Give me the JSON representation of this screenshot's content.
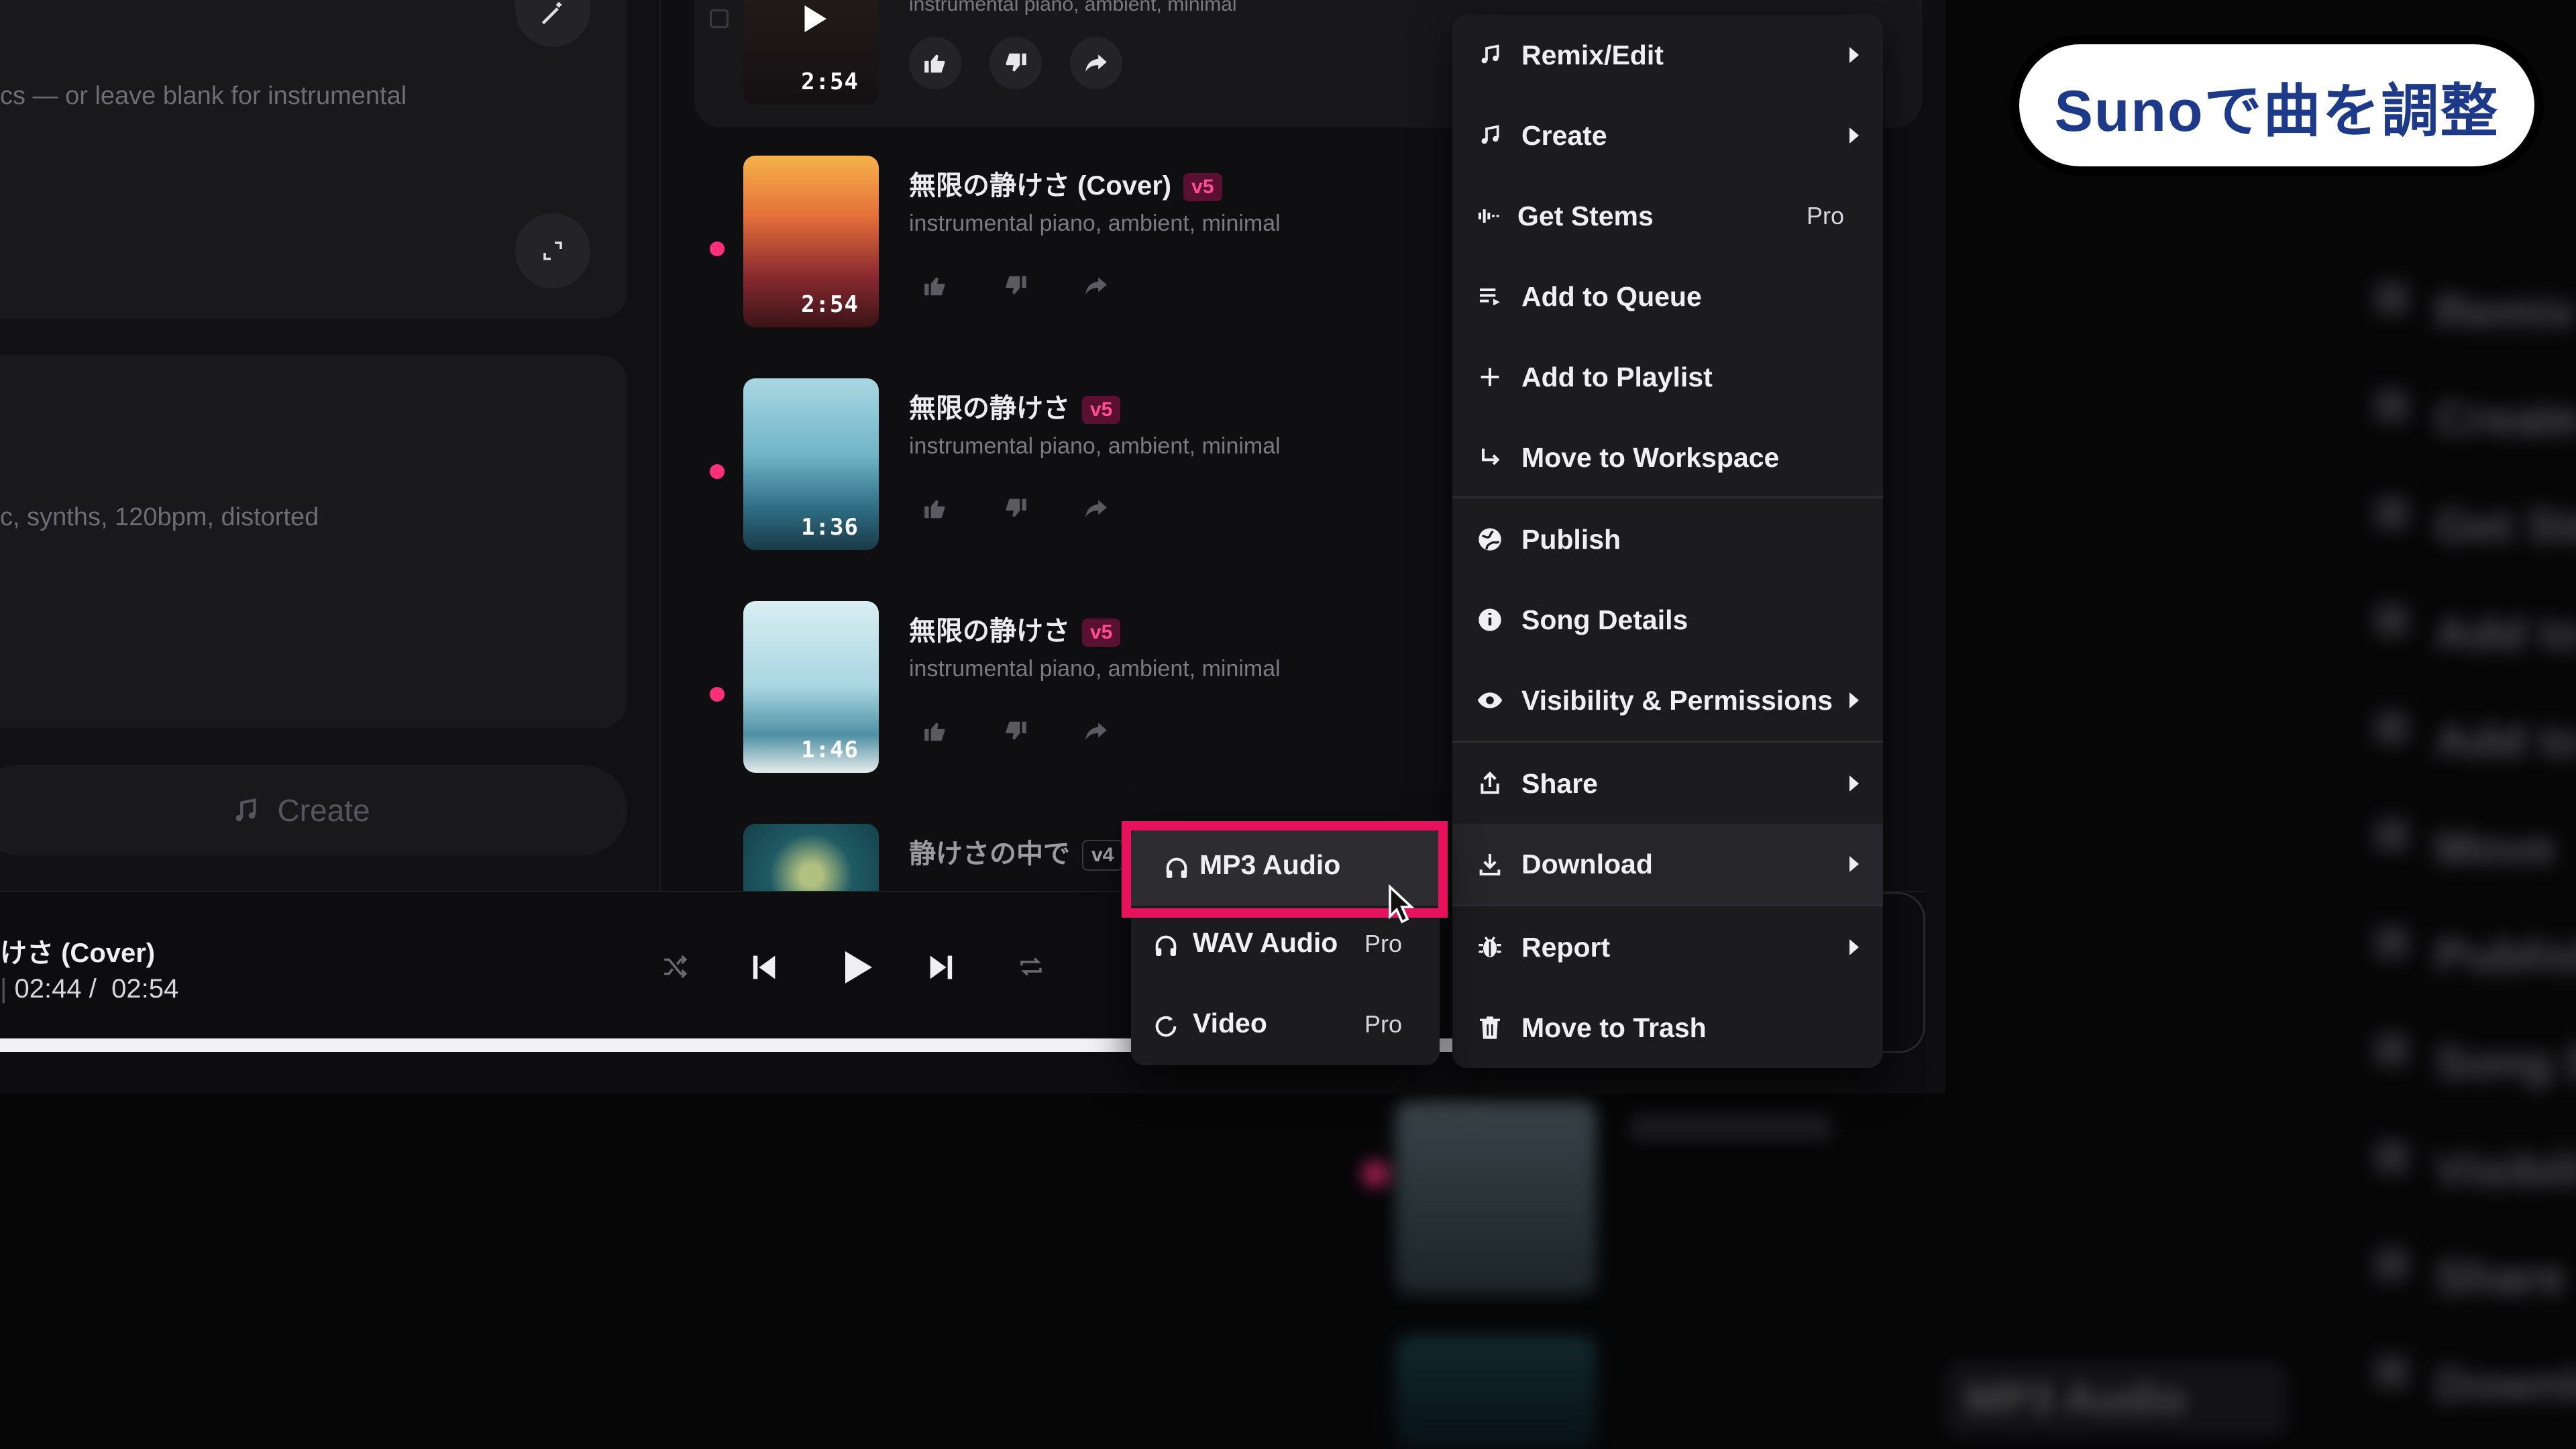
{
  "left_panel": {
    "lyrics_placeholder": "cs — or leave blank for instrumental",
    "style_placeholder": "c, synths, 120bpm, distorted",
    "create_button": "Create"
  },
  "tracks": [
    {
      "title": "",
      "tag": "",
      "subtitle": "instrumental piano, ambient, minimal",
      "duration": "2:54"
    },
    {
      "title": "無限の静けさ (Cover)",
      "tag": "v5",
      "subtitle": "instrumental piano, ambient, minimal",
      "duration": "2:54"
    },
    {
      "title": "無限の静けさ",
      "tag": "v5",
      "subtitle": "instrumental piano, ambient, minimal",
      "duration": "1:36"
    },
    {
      "title": "無限の静けさ",
      "tag": "v5",
      "subtitle": "instrumental piano, ambient, minimal",
      "duration": "1:46"
    },
    {
      "title": "静けさの中で",
      "tag": "v4",
      "subtitle": "",
      "duration": ""
    }
  ],
  "player": {
    "title": "けさ (Cover)",
    "current_time": "02:44",
    "separator": "/",
    "total_time": "02:54",
    "progress_fraction": 0.94
  },
  "context_menu": {
    "items": [
      {
        "label": "Remix/Edit",
        "icon": "music-edit-icon",
        "submenu": true
      },
      {
        "label": "Create",
        "icon": "music-note-icon",
        "submenu": true
      },
      {
        "label": "Get Stems",
        "icon": "stems-icon",
        "badge": "Pro"
      },
      {
        "label": "Add to Queue",
        "icon": "queue-icon"
      },
      {
        "label": "Add to Playlist",
        "icon": "plus-icon"
      },
      {
        "label": "Move to Workspace",
        "icon": "move-arrow-icon"
      },
      {
        "label": "Publish",
        "icon": "globe-icon"
      },
      {
        "label": "Song Details",
        "icon": "info-icon"
      },
      {
        "label": "Visibility & Permissions",
        "icon": "eye-icon",
        "submenu": true
      },
      {
        "label": "Share",
        "icon": "share-icon",
        "submenu": true
      },
      {
        "label": "Download",
        "icon": "download-icon",
        "submenu": true
      },
      {
        "label": "Report",
        "icon": "report-icon",
        "submenu": true
      },
      {
        "label": "Move to Trash",
        "icon": "trash-icon"
      }
    ]
  },
  "download_submenu": {
    "items": [
      {
        "label": "MP3 Audio",
        "icon": "headphones-icon",
        "highlighted": true
      },
      {
        "label": "WAV Audio",
        "icon": "headphones-icon",
        "badge": "Pro"
      },
      {
        "label": "Video",
        "icon": "video-icon",
        "badge": "Pro"
      }
    ]
  },
  "overlay_badge": "Sunoで曲を調整",
  "background_menu_ghost": [
    "Remix",
    "Create",
    "Get Ste",
    "Add to",
    "Add to",
    "Move",
    "Publish",
    "Song D",
    "Visibili",
    "Share",
    "Downlo"
  ],
  "background_ghost_download": "MP3 Audio",
  "colors": {
    "accent_pink": "#ff2f7a",
    "highlight_border": "#e8125c",
    "menu_bg": "#1c1c1f",
    "badge_text": "#1d3a8a"
  }
}
